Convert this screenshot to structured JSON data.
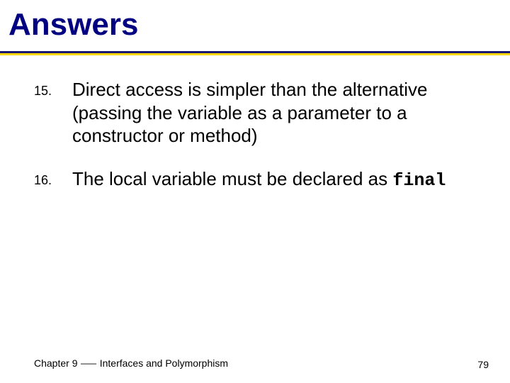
{
  "title": "Answers",
  "items": [
    {
      "num": "15.",
      "text": "Direct access is simpler than the alternative (passing the variable as a parameter to a constructor or method)"
    },
    {
      "num": "16.",
      "text_prefix": "The local variable must be declared as ",
      "code": "final"
    }
  ],
  "footer": {
    "left": "Chapter 9 ⸺ Interfaces and Polymorphism",
    "right": "79"
  }
}
